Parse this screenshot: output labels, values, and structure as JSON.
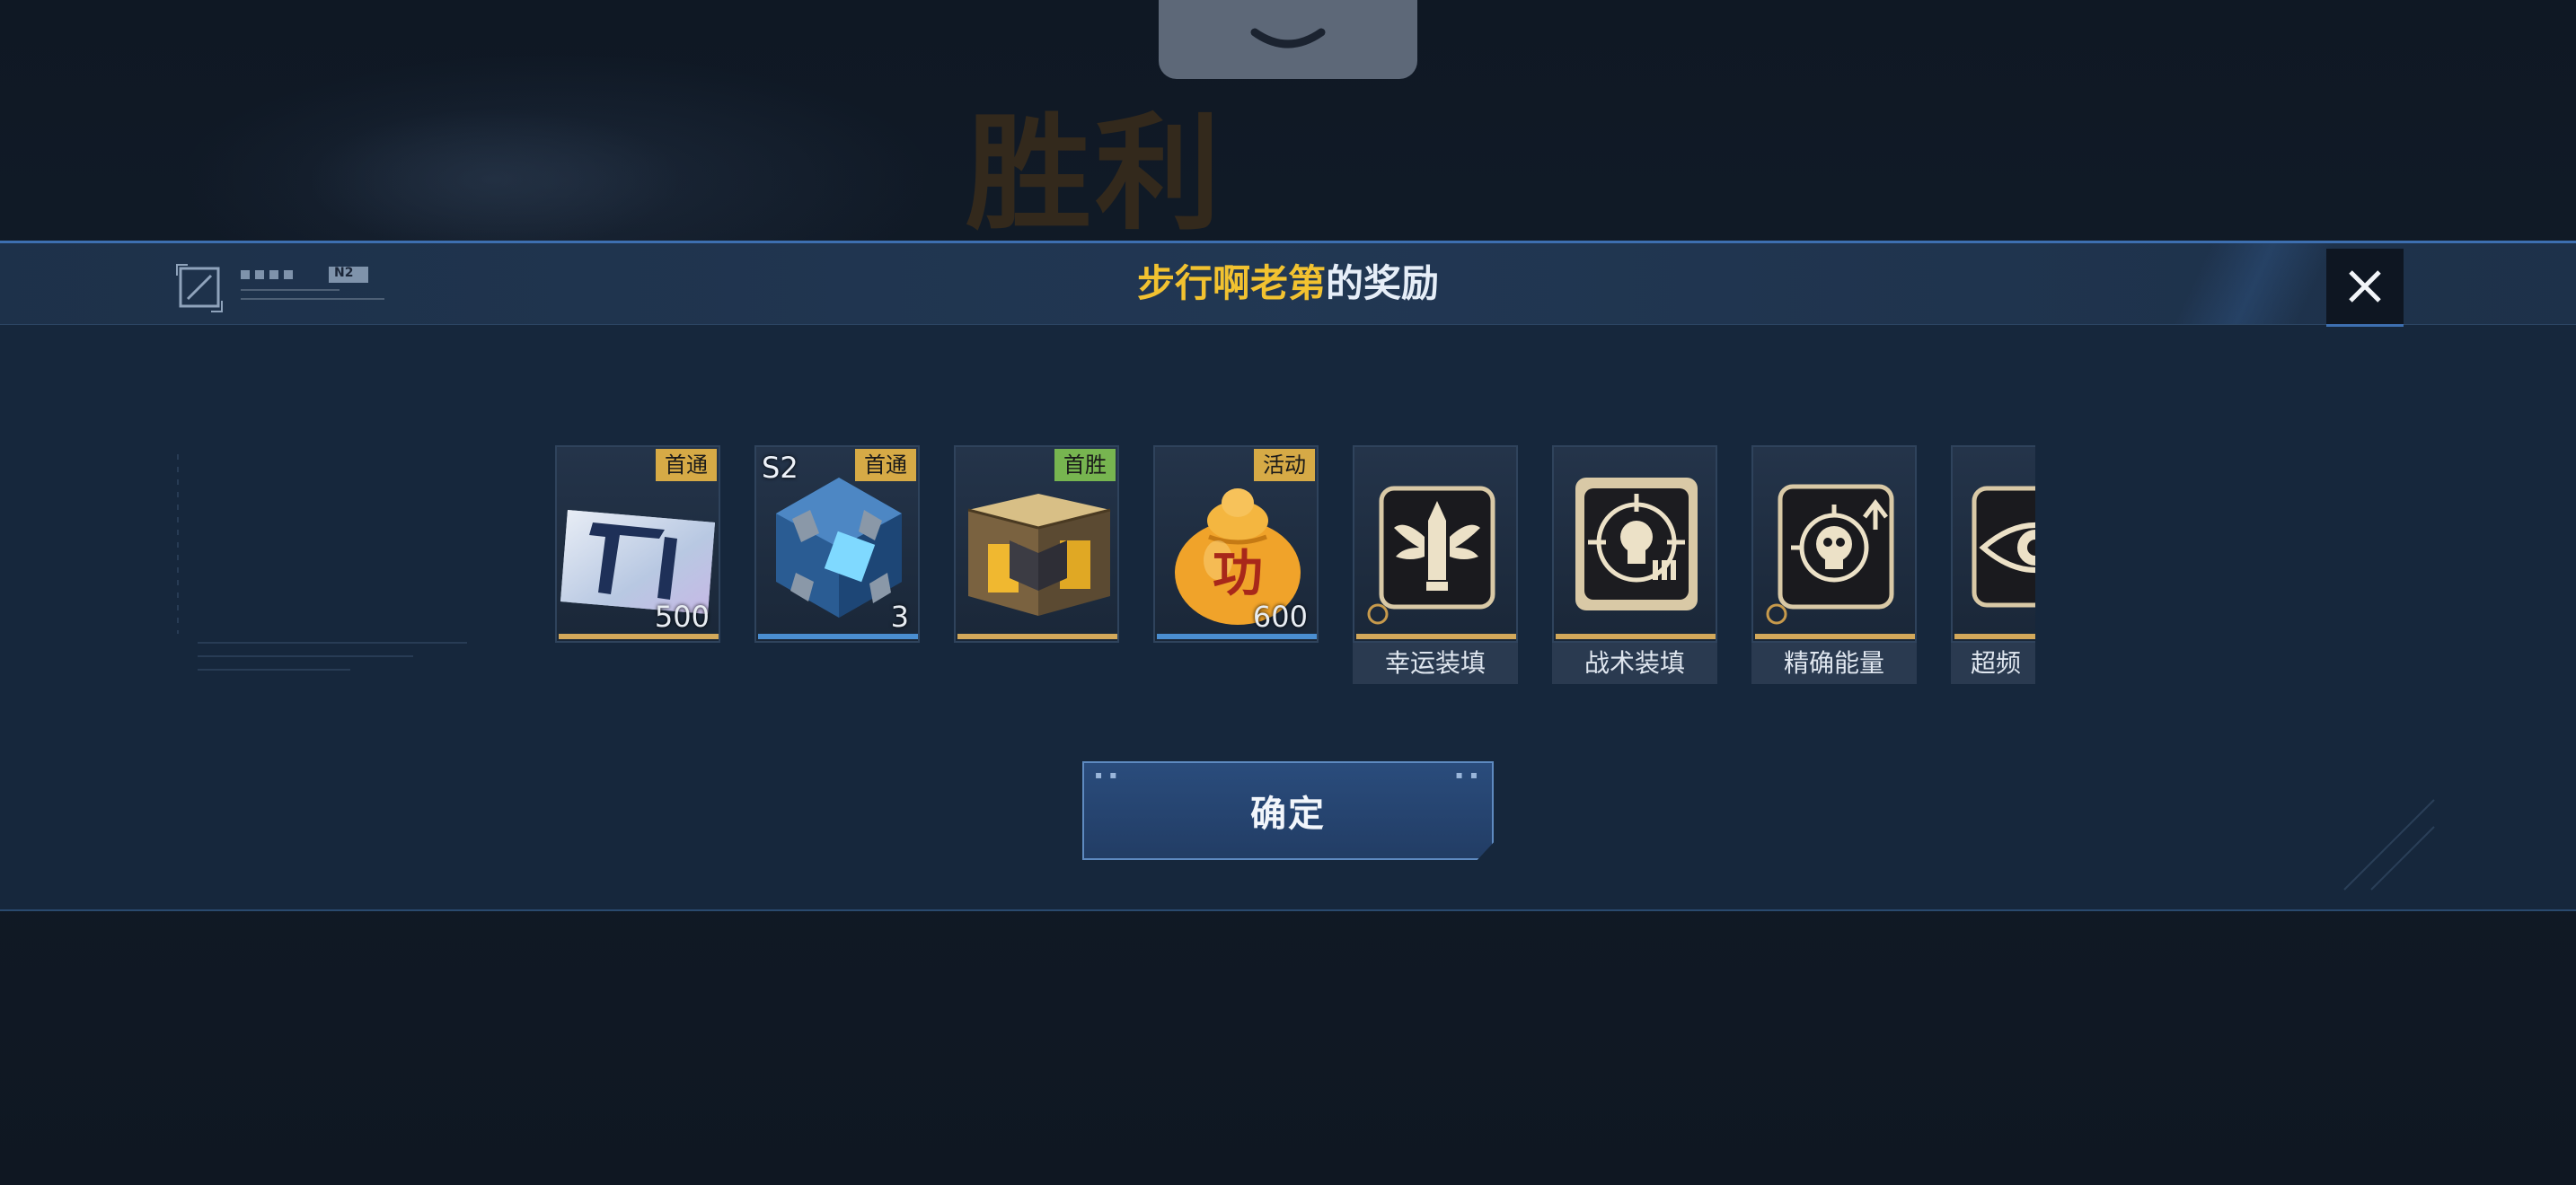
{
  "background": {
    "victory_text": "胜利"
  },
  "header": {
    "title_owner": "步行啊老第",
    "title_suffix": "的奖励",
    "logo_tag": "N2"
  },
  "rewards": [
    {
      "badge": "首通",
      "badge_color": "#d6aa46",
      "quantity": "500",
      "caption": "",
      "bar": "gold",
      "icon": "ticket-card-icon"
    },
    {
      "badge": "首通",
      "badge_color": "#d6aa46",
      "quantity": "3",
      "season": "S2",
      "caption": "",
      "bar": "blue",
      "icon": "blue-crystal-core-icon"
    },
    {
      "badge": "首胜",
      "badge_color": "#77b550",
      "quantity": "",
      "caption": "",
      "bar": "gold",
      "icon": "gold-supply-crate-icon"
    },
    {
      "badge": "活动",
      "badge_color": "#d6aa46",
      "quantity": "600",
      "caption": "",
      "bar": "blue",
      "icon": "merit-pouch-icon",
      "pouch_glyph": "功"
    },
    {
      "badge": "",
      "quantity": "",
      "caption": "幸运装填",
      "bar": "gold",
      "icon": "winged-bullet-icon"
    },
    {
      "badge": "",
      "quantity": "",
      "caption": "战术装填",
      "bar": "gold",
      "icon": "tactical-skull-target-icon"
    },
    {
      "badge": "",
      "quantity": "",
      "caption": "精确能量",
      "bar": "gold",
      "icon": "skull-crosshair-icon"
    },
    {
      "badge": "",
      "quantity": "",
      "caption": "超频",
      "bar": "gold",
      "icon": "eye-overclock-icon"
    }
  ],
  "confirm": {
    "label": "确定"
  },
  "colors": {
    "accent_blue": "#3d6fb0",
    "title_gold": "#f2c230",
    "badge_gold": "#d6aa46",
    "badge_green": "#77b550"
  }
}
